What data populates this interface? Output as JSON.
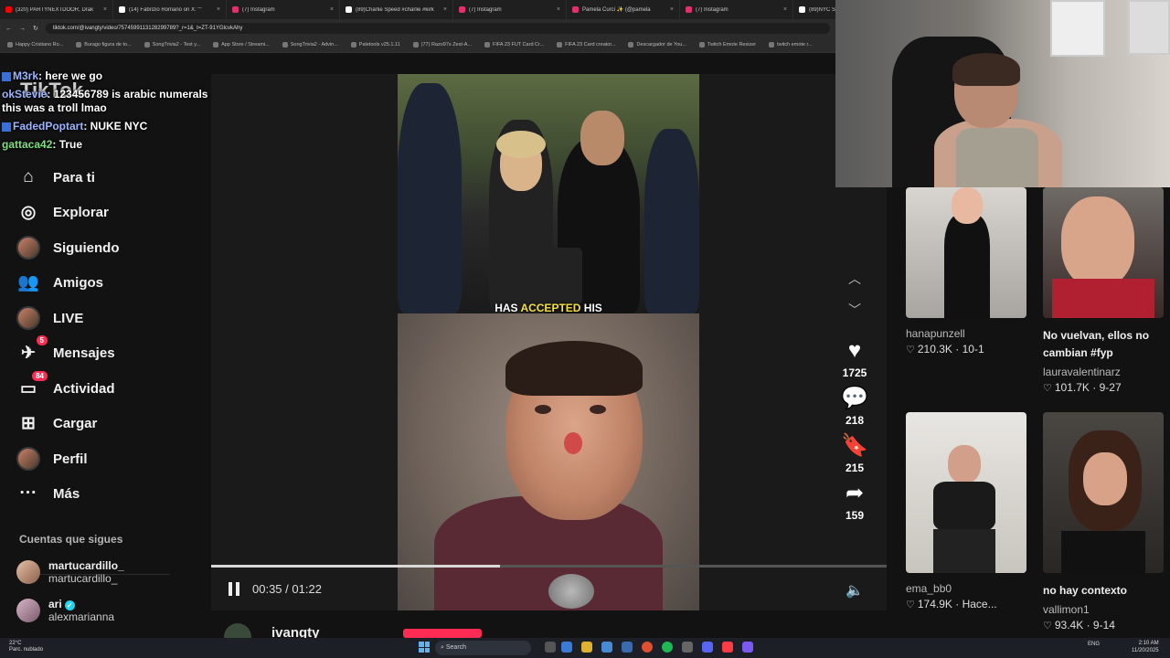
{
  "browser": {
    "tabs": [
      {
        "title": "(320) PARTYNEXTDOOR, Drak",
        "color": "#ff0000"
      },
      {
        "title": "(14) Fabrizio Romano on X: \"\"",
        "color": "#ffffff"
      },
      {
        "title": "(7) Instagram",
        "color": "#e1306c"
      },
      {
        "title": "(89)Charlie Speed #charlie #kirk",
        "color": "#ffffff"
      },
      {
        "title": "(7) Instagram",
        "color": "#e1306c"
      },
      {
        "title": "Pamela Curci ✨ (@pamela",
        "color": "#e1306c"
      },
      {
        "title": "(7) Instagram",
        "color": "#e1306c"
      },
      {
        "title": "(89)NYC Students",
        "color": "#ffffff"
      }
    ],
    "url": "tiktok.com/@ivangty/video/7574599113128299789?_r=1&_t=ZT-91YGlcvkAhy",
    "bookmarks": [
      "Happy Cristiano Ro...",
      "Burago figura de to...",
      "SongTrivia2 - Test y...",
      "App Store / Streami...",
      "SongTrivia2 - Advin...",
      "Paletools v25.1.11",
      "(77) Razo97s Zest-A...",
      "FIFA 23 FUT Card Cr...",
      "FIFA 23 Card creator...",
      "Descargador de You...",
      "Twitch Emote Resizer",
      "twitch emote r..."
    ]
  },
  "nav": {
    "logo": "TikTok",
    "items": [
      {
        "label": "Para ti",
        "icon": "home-icon",
        "glyph": "⌂"
      },
      {
        "label": "Explorar",
        "icon": "compass-icon",
        "glyph": "◎"
      },
      {
        "label": "Siguiendo",
        "icon": "following-avatar-icon",
        "glyph": ""
      },
      {
        "label": "Amigos",
        "icon": "friends-icon",
        "glyph": "👥"
      },
      {
        "label": "LIVE",
        "icon": "live-avatar-icon",
        "glyph": ""
      },
      {
        "label": "Mensajes",
        "icon": "messages-icon",
        "glyph": "✈",
        "badge": "5"
      },
      {
        "label": "Actividad",
        "icon": "activity-icon",
        "glyph": "▭",
        "badge": "84"
      },
      {
        "label": "Cargar",
        "icon": "upload-icon",
        "glyph": "⊞"
      },
      {
        "label": "Perfil",
        "icon": "profile-avatar-icon",
        "glyph": ""
      },
      {
        "label": "Más",
        "icon": "more-icon",
        "glyph": "···"
      }
    ],
    "following_title": "Cuentas que sigues",
    "accounts": [
      {
        "name": "martucardillo_",
        "handle": "martucardillo_",
        "verified": false
      },
      {
        "name": "ari",
        "handle": "alexmarianna",
        "verified": true
      }
    ]
  },
  "chat": [
    {
      "user": "M3rk",
      "text": ": here we go"
    },
    {
      "user": "okStevie",
      "text": ": 123456789 is arabic numerals this was a troll lmao"
    },
    {
      "user": "FadedPoptart",
      "text": ": NUKE NYC"
    },
    {
      "user": "gattaca42",
      "text": ": True"
    }
  ],
  "video": {
    "caption_before": "HAS ",
    "caption_highlight": "ACCEPTED",
    "caption_after": " HIS",
    "time_current": "00:35",
    "time_total": "01:22",
    "progress_fraction": 0.427,
    "author": "ivangty"
  },
  "actions": {
    "likes": "1725",
    "comments": "218",
    "saves": "215",
    "shares": "159"
  },
  "recommendations": [
    {
      "title": "",
      "user": "hanapunzell",
      "views": "210.3K",
      "date": "10-1"
    },
    {
      "title": "No vuelvan, ellos no cambian #fyp",
      "user": "lauravalentinarz",
      "views": "101.7K",
      "date": "9-27"
    },
    {
      "title": "",
      "user": "ema_bb0",
      "views": "174.9K",
      "date": "Hace..."
    },
    {
      "title": "no hay contexto",
      "user": "vallimon1",
      "views": "93.4K",
      "date": "9-14"
    }
  ],
  "taskbar": {
    "weather_temp": "22°C",
    "weather_desc": "Parc. nublado",
    "search": "Search",
    "lang": "ENG",
    "time": "2:10 AM",
    "date": "11/20/2025"
  }
}
